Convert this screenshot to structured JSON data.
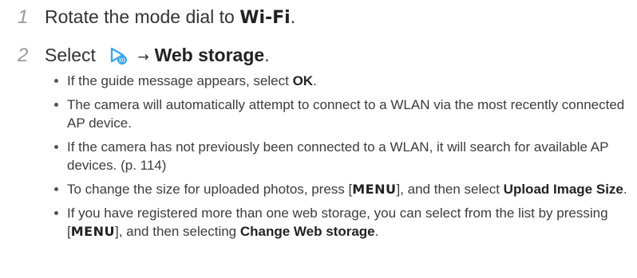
{
  "step1": {
    "number": "1",
    "text": "Rotate the mode dial to ",
    "mode": "Wi-Fi",
    "suffix": "."
  },
  "step2": {
    "number": "2",
    "select": "Select",
    "arrow": "→",
    "target": "Web storage",
    "suffix": ".",
    "icon": "wifi-share-icon"
  },
  "bullets": [
    {
      "pre": "If the guide message appears, select ",
      "bold": "OK",
      "post": "."
    },
    {
      "text": "The camera will automatically attempt to connect to a WLAN via the most recently connected AP device."
    },
    {
      "text": "If the camera has not previously been connected to a WLAN, it will search for available AP devices. (p. 114)"
    },
    {
      "pre": "To change the size for uploaded photos, press [",
      "key": "MENU",
      "mid": "], and then select ",
      "bold": "Upload Image Size",
      "post": "."
    },
    {
      "pre": "If you have registered more than one web storage, you can select from the list by pressing [",
      "key": "MENU",
      "mid": "], and then selecting ",
      "bold": "Change Web storage",
      "post": "."
    }
  ],
  "colors": {
    "step_number": "#9a9a9a",
    "text": "#3c3c3c",
    "icon_blue": "#3aa6e8"
  }
}
